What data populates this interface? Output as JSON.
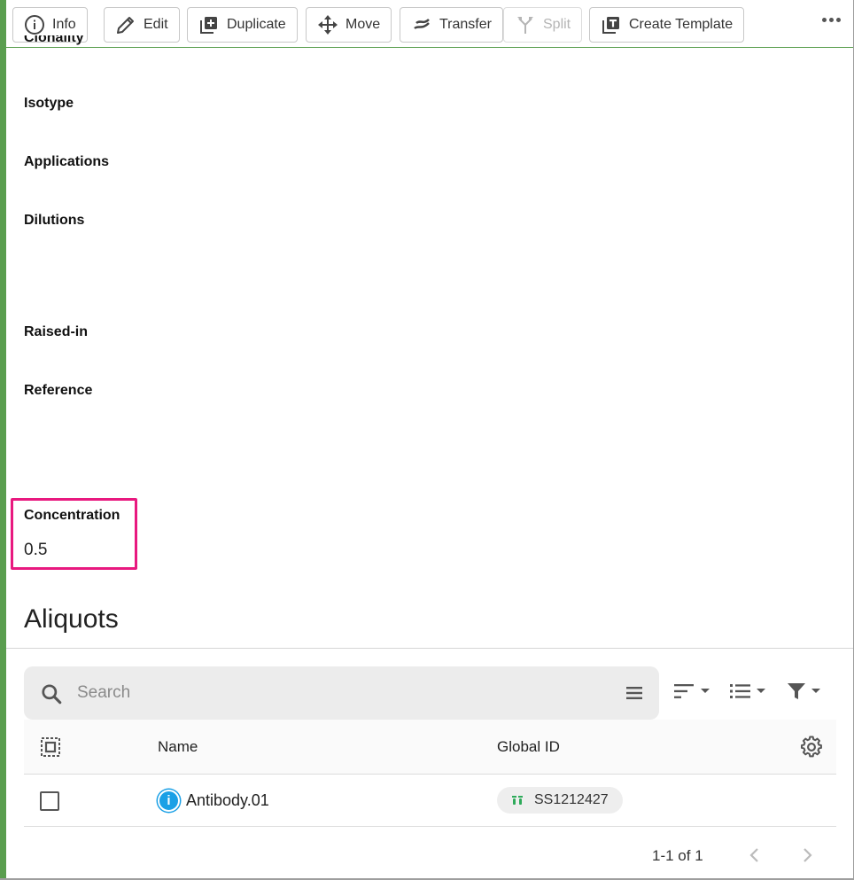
{
  "toolbar": {
    "info": "Info",
    "edit": "Edit",
    "duplicate": "Duplicate",
    "move": "Move",
    "transfer": "Transfer",
    "split": "Split",
    "create_template": "Create Template"
  },
  "fields": {
    "cut_off_label": "Clonality",
    "isotype": "Isotype",
    "applications": "Applications",
    "dilutions": "Dilutions",
    "raised_in": "Raised-in",
    "reference": "Reference",
    "concentration_label": "Concentration",
    "concentration_value": "0.5"
  },
  "aliquots": {
    "title": "Aliquots",
    "search_placeholder": "Search",
    "columns": {
      "name": "Name",
      "global_id": "Global ID"
    },
    "rows": [
      {
        "name": "Antibody.01",
        "global_id": "SS1212427"
      }
    ],
    "pagination": "1-1 of 1"
  },
  "colors": {
    "accent_green": "#5a9e4f",
    "highlight_pink": "#e8197f",
    "info_blue": "#1aa0e6",
    "sample_green": "#2eaa5a"
  }
}
